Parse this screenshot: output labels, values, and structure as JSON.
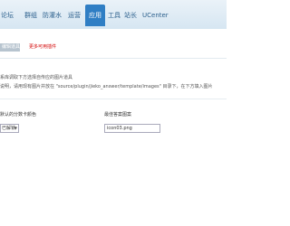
{
  "nav": {
    "items": [
      {
        "label": "论坛"
      },
      {
        "label": "群组"
      },
      {
        "label": "防灌水"
      },
      {
        "label": "运营"
      },
      {
        "label": "应用"
      },
      {
        "label": "工具"
      },
      {
        "label": "站长"
      },
      {
        "label": "UCenter"
      }
    ],
    "active_index": 4
  },
  "plugin": {
    "tag_label": "编辑道具",
    "warning": "更多可用插件"
  },
  "description": {
    "line1": "系库调取下方选择自传应的图片道具",
    "line2": "说明，请用现有图片并放在 \"source/plugin/jieko_answer/template/images\" 目录下，在下方填入图片"
  },
  "form": {
    "fields": {
      "default_label": "默认的分数卡颜色",
      "default_value": "已解锁",
      "image_label": "最佳答案图案",
      "image_value": "icon03.png"
    }
  }
}
